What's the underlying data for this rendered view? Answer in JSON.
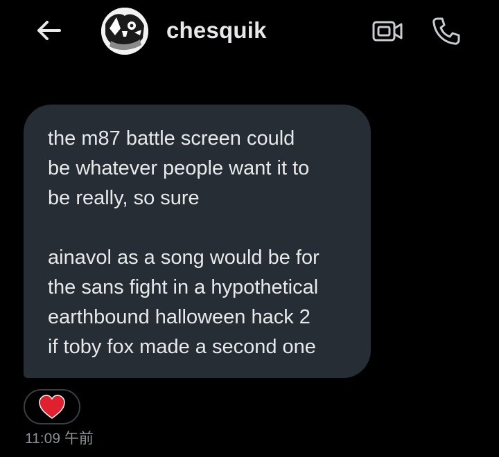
{
  "header": {
    "back_icon": "arrow-left-icon",
    "username": "chesquik",
    "video_icon": "video-camera-icon",
    "call_icon": "phone-icon"
  },
  "message": {
    "paragraphs": [
      "the m87 battle screen could\nbe whatever people want it to\nbe really, so sure",
      "ainavol as a song would be for\nthe sans fight in a hypothetical\nearthbound halloween hack 2\nif toby fox made a second one"
    ],
    "reaction_icon": "heart-icon",
    "timestamp": "11:09 午前"
  },
  "colors": {
    "background": "#000000",
    "bubble": "#262d34",
    "text": "#e7e9ea",
    "muted": "#8b9095",
    "heart": "#e0202e"
  }
}
